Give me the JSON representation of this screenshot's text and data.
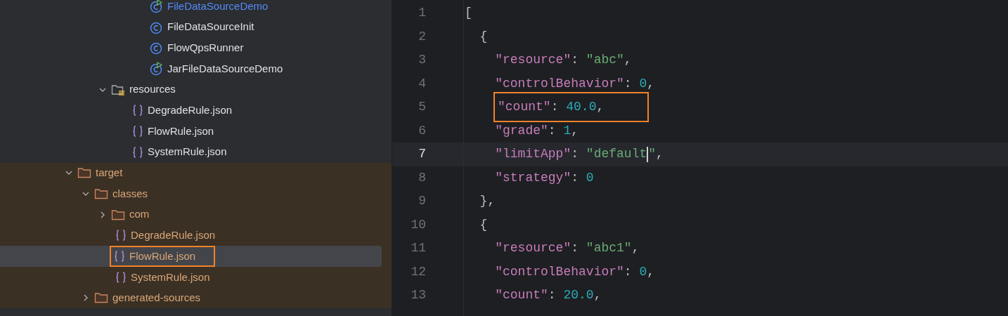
{
  "tree": [
    {
      "kind": "class",
      "label": "FileDataSourceDemo",
      "runnable": true,
      "modified": true,
      "selected": false
    },
    {
      "kind": "class",
      "label": "FileDataSourceInit",
      "runnable": false,
      "modified": false,
      "selected": false
    },
    {
      "kind": "class",
      "label": "FlowQpsRunner",
      "runnable": false,
      "modified": false,
      "selected": false
    },
    {
      "kind": "class",
      "label": "JarFileDataSourceDemo",
      "runnable": true,
      "modified": false,
      "selected": false
    },
    {
      "kind": "resource-folder",
      "label": "resources",
      "expanded": true,
      "selected": false,
      "children": [
        {
          "kind": "json",
          "label": "DegradeRule.json",
          "selected": false
        },
        {
          "kind": "json",
          "label": "FlowRule.json",
          "selected": false
        },
        {
          "kind": "json",
          "label": "SystemRule.json",
          "selected": false
        }
      ]
    },
    {
      "kind": "folder",
      "label": "target",
      "expanded": true,
      "excluded": true,
      "selected": false,
      "children": [
        {
          "kind": "folder",
          "label": "classes",
          "expanded": true,
          "selected": false,
          "children": [
            {
              "kind": "folder",
              "label": "com",
              "expanded": false,
              "selected": false
            },
            {
              "kind": "json",
              "label": "DegradeRule.json",
              "selected": false
            },
            {
              "kind": "json",
              "label": "FlowRule.json",
              "selected": true,
              "annotated": true
            },
            {
              "kind": "json",
              "label": "SystemRule.json",
              "selected": false
            }
          ]
        },
        {
          "kind": "folder",
          "label": "generated-sources",
          "expanded": false,
          "selected": false
        }
      ]
    }
  ],
  "editor": {
    "lines": [
      {
        "number": "1",
        "current": false,
        "tokens": [
          {
            "kind": "punct",
            "text": "["
          }
        ]
      },
      {
        "number": "2",
        "current": false,
        "tokens": [
          {
            "kind": "punct",
            "text": "  {"
          }
        ]
      },
      {
        "number": "3",
        "current": false,
        "tokens": [
          {
            "kind": "key",
            "text": "    \"resource\""
          },
          {
            "kind": "punct",
            "text": ": "
          },
          {
            "kind": "string",
            "text": "\"abc\""
          },
          {
            "kind": "punct",
            "text": ","
          }
        ]
      },
      {
        "number": "4",
        "current": false,
        "tokens": [
          {
            "kind": "key",
            "text": "    \"controlBehavior\""
          },
          {
            "kind": "punct",
            "text": ": "
          },
          {
            "kind": "number",
            "text": "0"
          },
          {
            "kind": "punct",
            "text": ","
          }
        ]
      },
      {
        "number": "5",
        "current": false,
        "annotated": true,
        "tokens": [
          {
            "kind": "key",
            "text": "\"count\""
          },
          {
            "kind": "punct",
            "text": ": "
          },
          {
            "kind": "number",
            "text": "40.0"
          },
          {
            "kind": "punct",
            "text": ","
          }
        ]
      },
      {
        "number": "6",
        "current": false,
        "tokens": [
          {
            "kind": "key",
            "text": "    \"grade\""
          },
          {
            "kind": "punct",
            "text": ": "
          },
          {
            "kind": "number",
            "text": "1"
          },
          {
            "kind": "punct",
            "text": ","
          }
        ]
      },
      {
        "number": "7",
        "current": true,
        "tokens": [
          {
            "kind": "key",
            "text": "    \"limitApp\""
          },
          {
            "kind": "punct",
            "text": ": "
          },
          {
            "kind": "string",
            "text": "\"default"
          },
          {
            "kind": "cursor"
          },
          {
            "kind": "string",
            "text": "\""
          },
          {
            "kind": "punct",
            "text": ","
          }
        ]
      },
      {
        "number": "8",
        "current": false,
        "tokens": [
          {
            "kind": "key",
            "text": "    \"strategy\""
          },
          {
            "kind": "punct",
            "text": ": "
          },
          {
            "kind": "number",
            "text": "0"
          }
        ]
      },
      {
        "number": "9",
        "current": false,
        "tokens": [
          {
            "kind": "punct",
            "text": "  },"
          }
        ]
      },
      {
        "number": "10",
        "current": false,
        "tokens": [
          {
            "kind": "punct",
            "text": "  {"
          }
        ]
      },
      {
        "number": "11",
        "current": false,
        "tokens": [
          {
            "kind": "key",
            "text": "    \"resource\""
          },
          {
            "kind": "punct",
            "text": ": "
          },
          {
            "kind": "string",
            "text": "\"abc1\""
          },
          {
            "kind": "punct",
            "text": ","
          }
        ]
      },
      {
        "number": "12",
        "current": false,
        "tokens": [
          {
            "kind": "key",
            "text": "    \"controlBehavior\""
          },
          {
            "kind": "punct",
            "text": ": "
          },
          {
            "kind": "number",
            "text": "0"
          },
          {
            "kind": "punct",
            "text": ","
          }
        ]
      },
      {
        "number": "13",
        "current": false,
        "tokens": [
          {
            "kind": "key",
            "text": "    \"count\""
          },
          {
            "kind": "punct",
            "text": ": "
          },
          {
            "kind": "number",
            "text": "20.0"
          },
          {
            "kind": "punct",
            "text": ","
          }
        ]
      }
    ]
  }
}
